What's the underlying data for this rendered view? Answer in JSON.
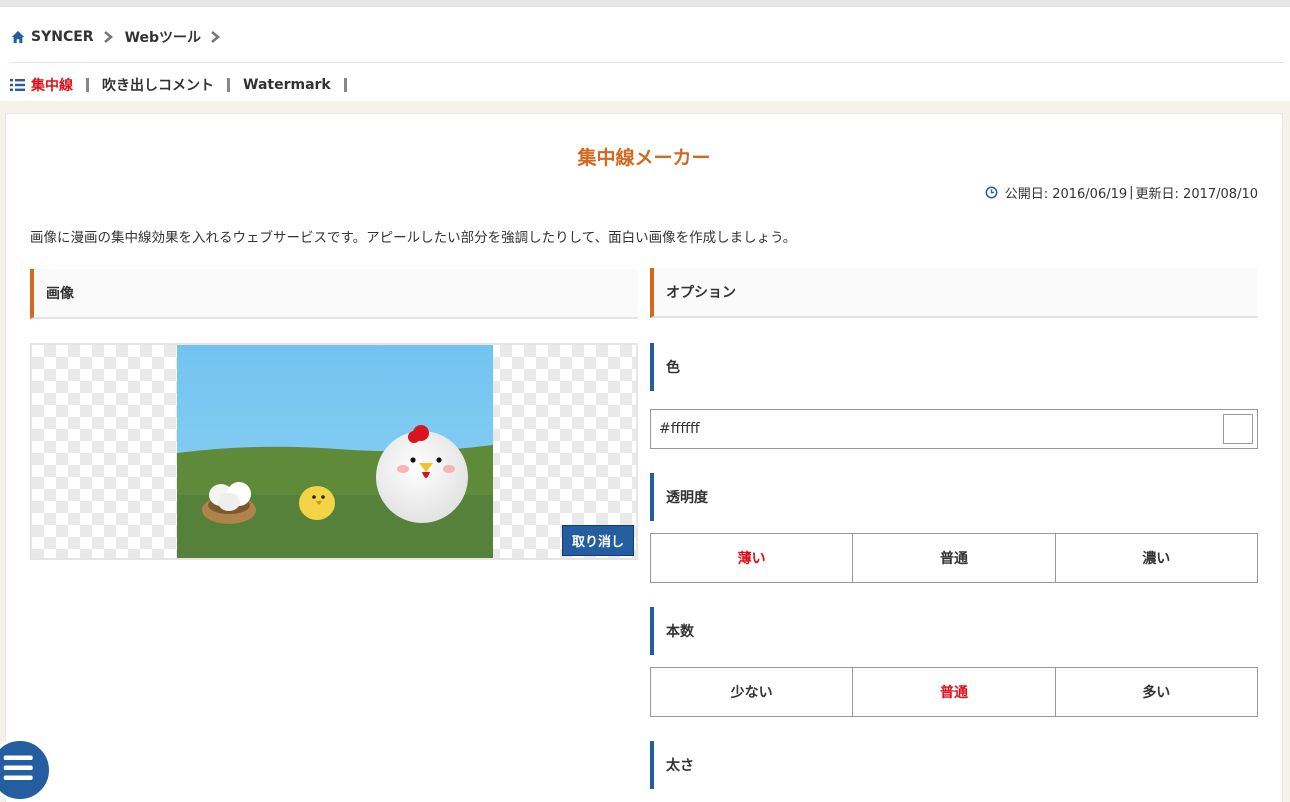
{
  "breadcrumb": {
    "home_label": "SYNCER",
    "second_label": "Webツール"
  },
  "subnav": {
    "items": [
      {
        "label": "集中線",
        "active": true
      },
      {
        "label": "吹き出しコメント",
        "active": false
      },
      {
        "label": "Watermark",
        "active": false
      }
    ]
  },
  "page": {
    "title": "集中線メーカー",
    "published_label": "公開日: 2016/06/19",
    "separator": "|",
    "updated_label": "更新日: 2017/08/10",
    "intro": "画像に漫画の集中線効果を入れるウェブサービスです。アピールしたい部分を強調したりして、面白い画像を作成しましょう。"
  },
  "image_section": {
    "heading": "画像",
    "cancel_label": "取り消し"
  },
  "options": {
    "heading": "オプション",
    "color": {
      "label": "色",
      "value": "#ffffff",
      "swatch": "#ffffff"
    },
    "opacity": {
      "label": "透明度",
      "choices": [
        "薄い",
        "普通",
        "濃い"
      ],
      "selected": "薄い"
    },
    "count": {
      "label": "本数",
      "choices": [
        "少ない",
        "普通",
        "多い"
      ],
      "selected": "普通"
    },
    "thickness": {
      "label": "太さ"
    }
  },
  "colors": {
    "accent_orange": "#d2691e",
    "accent_blue": "#255ea0",
    "active_red": "#e0101a"
  }
}
